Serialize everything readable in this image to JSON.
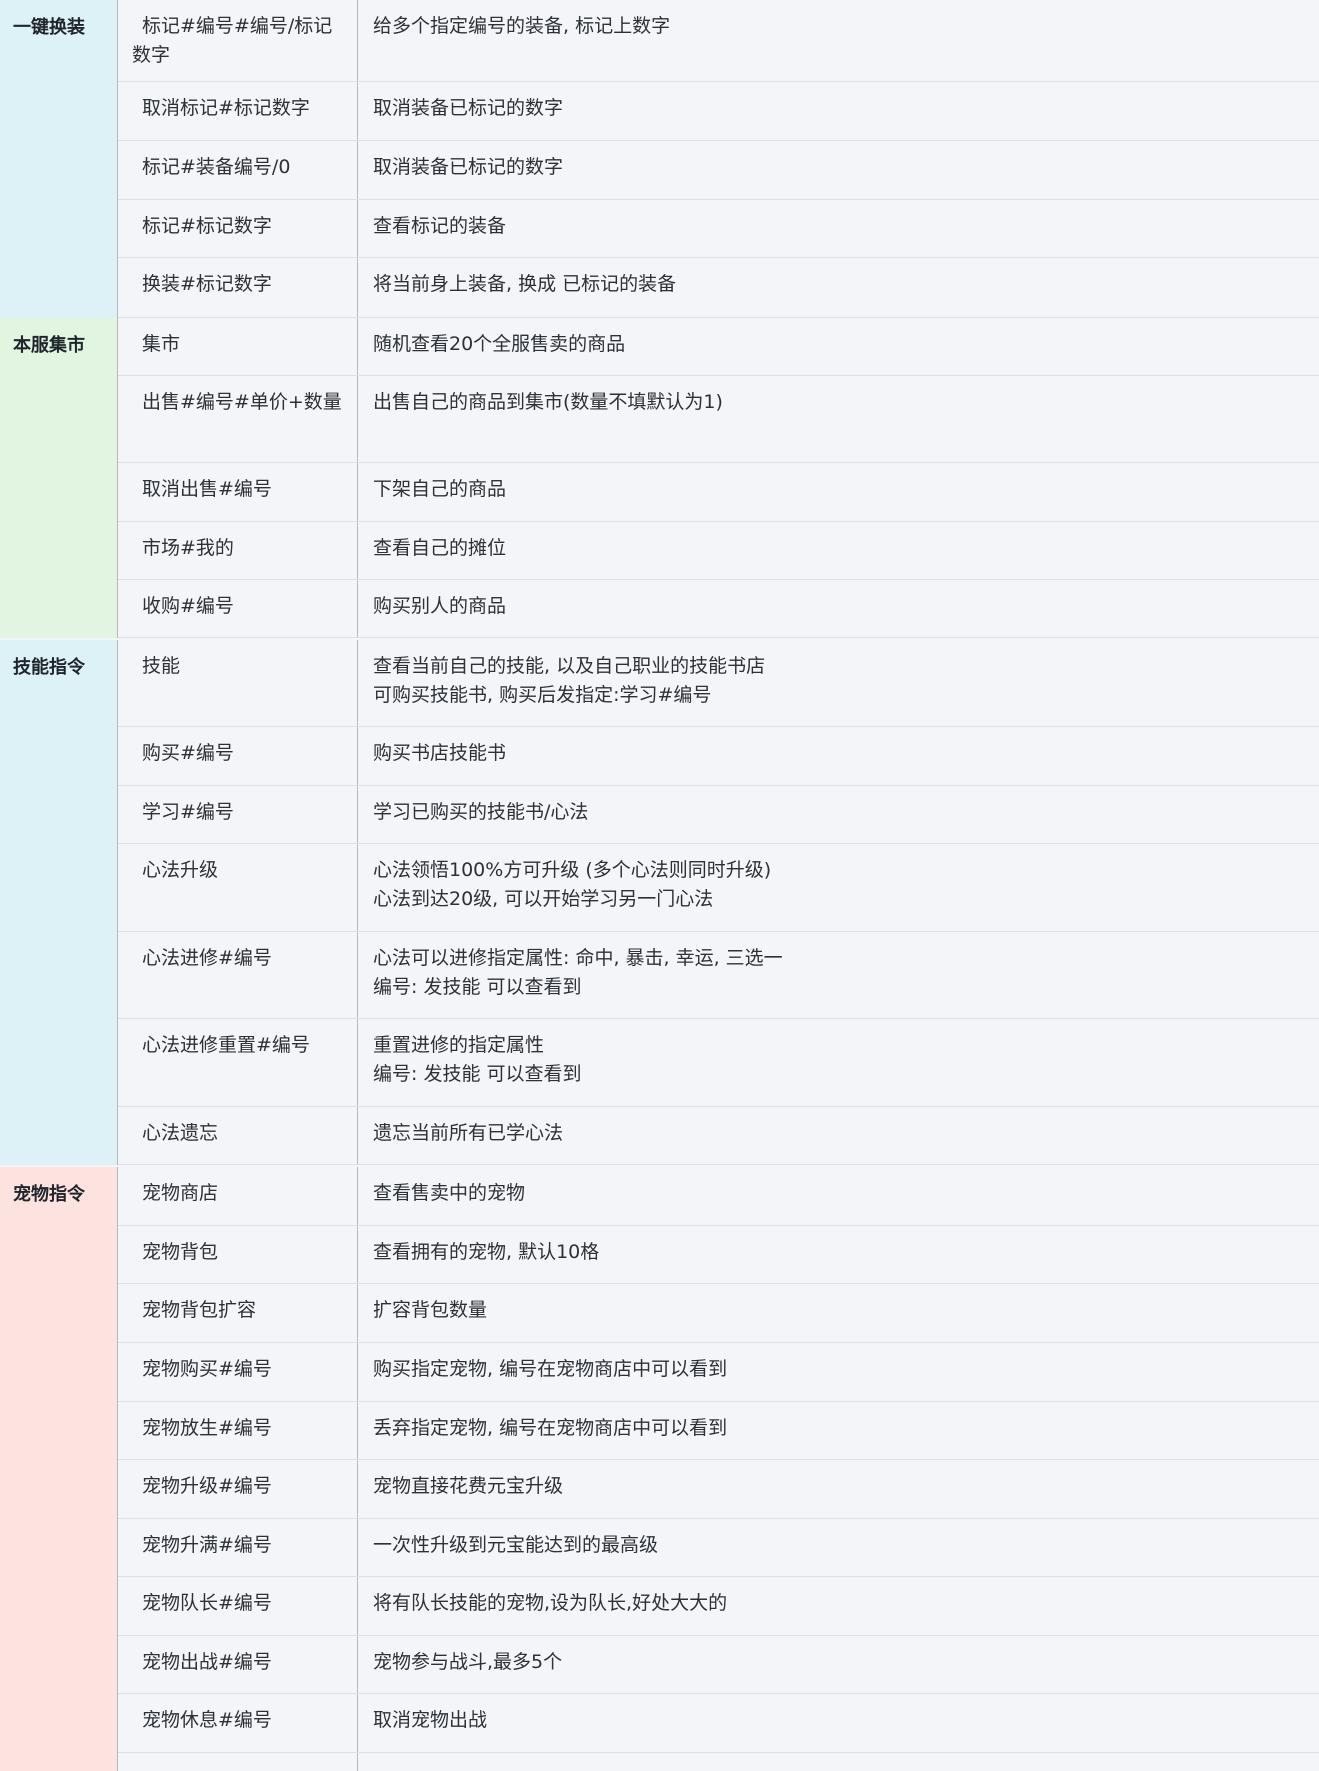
{
  "groups": [
    {
      "name": "一键换装",
      "rows": [
        {
          "command": "标记#编号#编号/标记数字",
          "description": [
            "给多个指定编号的装备, 标记上数字"
          ]
        },
        {
          "command": "取消标记#标记数字",
          "description": [
            "取消装备已标记的数字"
          ]
        },
        {
          "command": "标记#装备编号/0",
          "description": [
            "取消装备已标记的数字"
          ]
        },
        {
          "command": "标记#标记数字",
          "description": [
            "查看标记的装备"
          ]
        },
        {
          "command": "换装#标记数字",
          "description": [
            "将当前身上装备, 换成 已标记的装备"
          ]
        }
      ]
    },
    {
      "name": "本服集市",
      "rows": [
        {
          "command": "集市",
          "description": [
            "随机查看20个全服售卖的商品"
          ]
        },
        {
          "command": "出售#编号#单价+数量",
          "description": [
            "出售自己的商品到集市(数量不填默认为1)"
          ]
        },
        {
          "command": "取消出售#编号",
          "description": [
            "下架自己的商品"
          ]
        },
        {
          "command": "市场#我的",
          "description": [
            "查看自己的摊位"
          ]
        },
        {
          "command": "收购#编号",
          "description": [
            "购买别人的商品"
          ]
        }
      ]
    },
    {
      "name": "技能指令",
      "rows": [
        {
          "command": "技能",
          "description": [
            "查看当前自己的技能, 以及自己职业的技能书店",
            "可购买技能书, 购买后发指定:学习#编号"
          ]
        },
        {
          "command": "购买#编号",
          "description": [
            "购买书店技能书"
          ]
        },
        {
          "command": "学习#编号",
          "description": [
            "学习已购买的技能书/心法"
          ]
        },
        {
          "command": "心法升级",
          "description": [
            "心法领悟100%方可升级 (多个心法则同时升级)",
            "心法到达20级, 可以开始学习另一门心法"
          ]
        },
        {
          "command": "心法进修#编号",
          "description": [
            "心法可以进修指定属性: 命中, 暴击, 幸运, 三选一",
            "编号: 发技能 可以查看到"
          ]
        },
        {
          "command": "心法进修重置#编号",
          "description": [
            "重置进修的指定属性",
            "编号: 发技能 可以查看到"
          ]
        },
        {
          "command": "心法遗忘",
          "description": [
            "遗忘当前所有已学心法"
          ]
        }
      ]
    },
    {
      "name": "宠物指令",
      "rows": [
        {
          "command": "宠物商店",
          "description": [
            "查看售卖中的宠物"
          ]
        },
        {
          "command": "宠物背包",
          "description": [
            "查看拥有的宠物, 默认10格"
          ]
        },
        {
          "command": "宠物背包扩容",
          "description": [
            "扩容背包数量"
          ]
        },
        {
          "command": "宠物购买#编号",
          "description": [
            "购买指定宠物, 编号在宠物商店中可以看到"
          ]
        },
        {
          "command": "宠物放生#编号",
          "description": [
            "丢弃指定宠物, 编号在宠物商店中可以看到"
          ]
        },
        {
          "command": "宠物升级#编号",
          "description": [
            "宠物直接花费元宝升级"
          ]
        },
        {
          "command": "宠物升满#编号",
          "description": [
            "一次性升级到元宝能达到的最高级"
          ]
        },
        {
          "command": "宠物队长#编号",
          "description": [
            "将有队长技能的宠物,设为队长,好处大大的"
          ]
        },
        {
          "command": "宠物出战#编号",
          "description": [
            "宠物参与战斗,最多5个"
          ]
        },
        {
          "command": "宠物休息#编号",
          "description": [
            "取消宠物出战"
          ]
        },
        {
          "command": "",
          "description": []
        }
      ]
    }
  ]
}
